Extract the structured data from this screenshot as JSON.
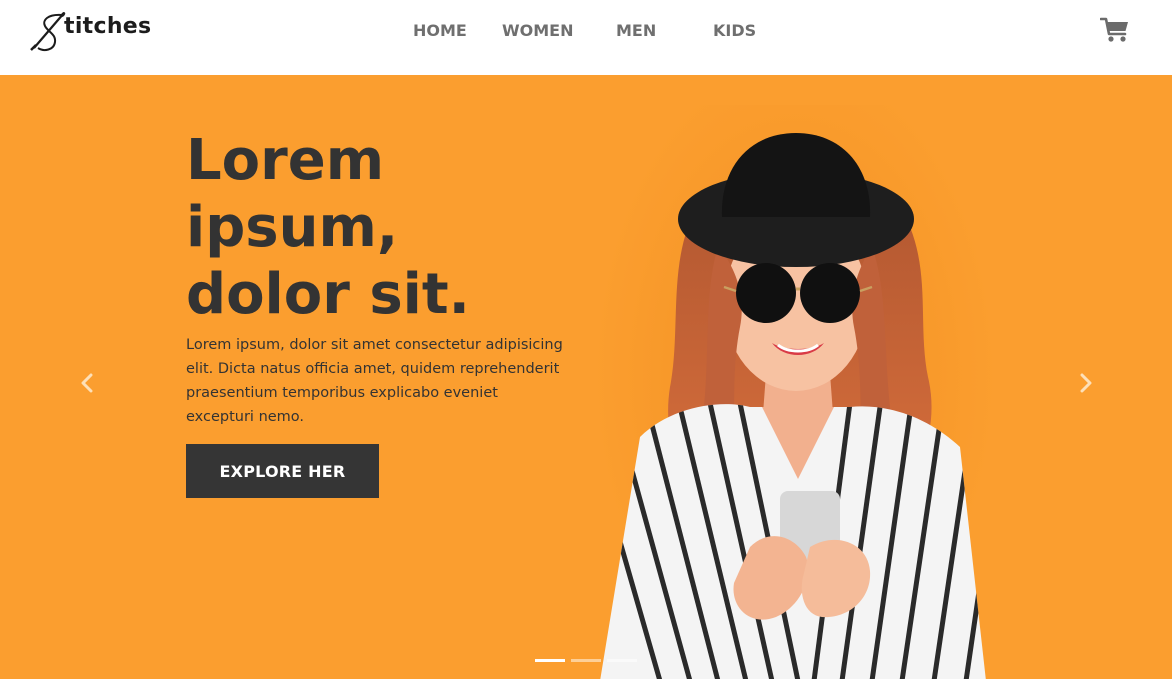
{
  "brand": {
    "name": "titches"
  },
  "nav": {
    "items": [
      {
        "label": "HOME"
      },
      {
        "label": "WOMEN"
      },
      {
        "label": "MEN"
      },
      {
        "label": "KIDS"
      }
    ],
    "cart_icon": "shopping-cart-icon"
  },
  "hero": {
    "headline_lines": [
      "Lorem",
      "ipsum,",
      "dolor sit."
    ],
    "description": "Lorem ipsum, dolor sit amet consectetur adipisicing elit. Dicta natus officia amet, quidem reprehenderit praesentium temporibus explicabo eveniet excepturi nemo.",
    "cta_label": "EXPLORE HER",
    "prev_icon": "chevron-left-icon",
    "next_icon": "chevron-right-icon",
    "slide_count": 3,
    "active_slide": 1
  },
  "colors": {
    "hero_background": "#fb9e2f",
    "headline": "#333333",
    "button_background": "#353535",
    "nav_text": "#6f6f6f"
  }
}
